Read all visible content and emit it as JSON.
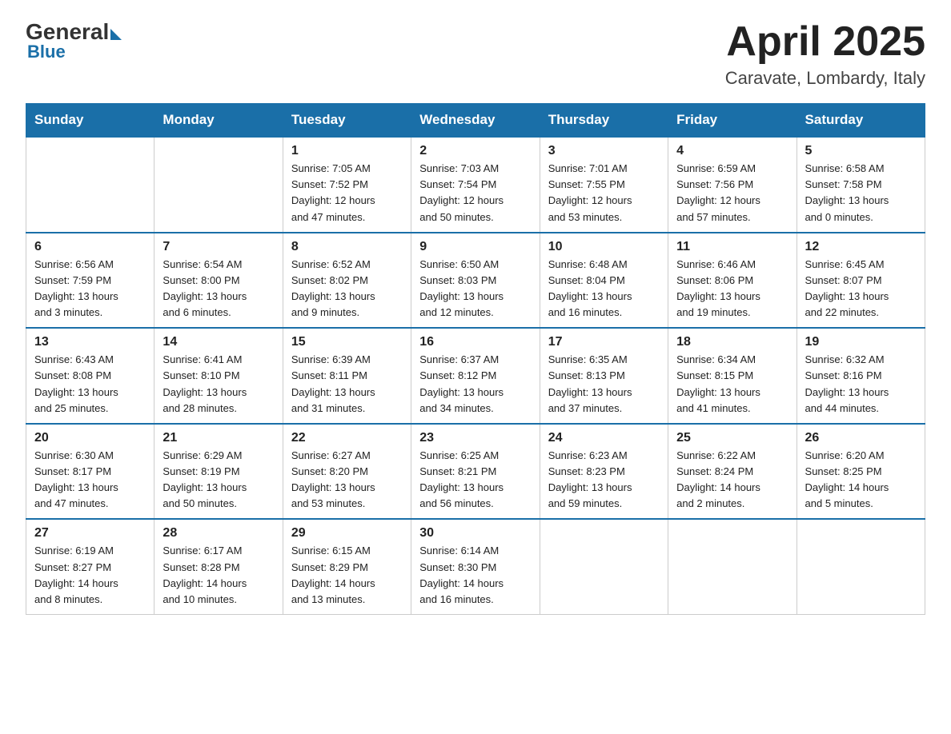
{
  "logo": {
    "general": "General",
    "triangle": "",
    "blue": "Blue"
  },
  "header": {
    "title": "April 2025",
    "subtitle": "Caravate, Lombardy, Italy"
  },
  "weekdays": [
    "Sunday",
    "Monday",
    "Tuesday",
    "Wednesday",
    "Thursday",
    "Friday",
    "Saturday"
  ],
  "weeks": [
    [
      {
        "day": "",
        "info": ""
      },
      {
        "day": "",
        "info": ""
      },
      {
        "day": "1",
        "info": "Sunrise: 7:05 AM\nSunset: 7:52 PM\nDaylight: 12 hours\nand 47 minutes."
      },
      {
        "day": "2",
        "info": "Sunrise: 7:03 AM\nSunset: 7:54 PM\nDaylight: 12 hours\nand 50 minutes."
      },
      {
        "day": "3",
        "info": "Sunrise: 7:01 AM\nSunset: 7:55 PM\nDaylight: 12 hours\nand 53 minutes."
      },
      {
        "day": "4",
        "info": "Sunrise: 6:59 AM\nSunset: 7:56 PM\nDaylight: 12 hours\nand 57 minutes."
      },
      {
        "day": "5",
        "info": "Sunrise: 6:58 AM\nSunset: 7:58 PM\nDaylight: 13 hours\nand 0 minutes."
      }
    ],
    [
      {
        "day": "6",
        "info": "Sunrise: 6:56 AM\nSunset: 7:59 PM\nDaylight: 13 hours\nand 3 minutes."
      },
      {
        "day": "7",
        "info": "Sunrise: 6:54 AM\nSunset: 8:00 PM\nDaylight: 13 hours\nand 6 minutes."
      },
      {
        "day": "8",
        "info": "Sunrise: 6:52 AM\nSunset: 8:02 PM\nDaylight: 13 hours\nand 9 minutes."
      },
      {
        "day": "9",
        "info": "Sunrise: 6:50 AM\nSunset: 8:03 PM\nDaylight: 13 hours\nand 12 minutes."
      },
      {
        "day": "10",
        "info": "Sunrise: 6:48 AM\nSunset: 8:04 PM\nDaylight: 13 hours\nand 16 minutes."
      },
      {
        "day": "11",
        "info": "Sunrise: 6:46 AM\nSunset: 8:06 PM\nDaylight: 13 hours\nand 19 minutes."
      },
      {
        "day": "12",
        "info": "Sunrise: 6:45 AM\nSunset: 8:07 PM\nDaylight: 13 hours\nand 22 minutes."
      }
    ],
    [
      {
        "day": "13",
        "info": "Sunrise: 6:43 AM\nSunset: 8:08 PM\nDaylight: 13 hours\nand 25 minutes."
      },
      {
        "day": "14",
        "info": "Sunrise: 6:41 AM\nSunset: 8:10 PM\nDaylight: 13 hours\nand 28 minutes."
      },
      {
        "day": "15",
        "info": "Sunrise: 6:39 AM\nSunset: 8:11 PM\nDaylight: 13 hours\nand 31 minutes."
      },
      {
        "day": "16",
        "info": "Sunrise: 6:37 AM\nSunset: 8:12 PM\nDaylight: 13 hours\nand 34 minutes."
      },
      {
        "day": "17",
        "info": "Sunrise: 6:35 AM\nSunset: 8:13 PM\nDaylight: 13 hours\nand 37 minutes."
      },
      {
        "day": "18",
        "info": "Sunrise: 6:34 AM\nSunset: 8:15 PM\nDaylight: 13 hours\nand 41 minutes."
      },
      {
        "day": "19",
        "info": "Sunrise: 6:32 AM\nSunset: 8:16 PM\nDaylight: 13 hours\nand 44 minutes."
      }
    ],
    [
      {
        "day": "20",
        "info": "Sunrise: 6:30 AM\nSunset: 8:17 PM\nDaylight: 13 hours\nand 47 minutes."
      },
      {
        "day": "21",
        "info": "Sunrise: 6:29 AM\nSunset: 8:19 PM\nDaylight: 13 hours\nand 50 minutes."
      },
      {
        "day": "22",
        "info": "Sunrise: 6:27 AM\nSunset: 8:20 PM\nDaylight: 13 hours\nand 53 minutes."
      },
      {
        "day": "23",
        "info": "Sunrise: 6:25 AM\nSunset: 8:21 PM\nDaylight: 13 hours\nand 56 minutes."
      },
      {
        "day": "24",
        "info": "Sunrise: 6:23 AM\nSunset: 8:23 PM\nDaylight: 13 hours\nand 59 minutes."
      },
      {
        "day": "25",
        "info": "Sunrise: 6:22 AM\nSunset: 8:24 PM\nDaylight: 14 hours\nand 2 minutes."
      },
      {
        "day": "26",
        "info": "Sunrise: 6:20 AM\nSunset: 8:25 PM\nDaylight: 14 hours\nand 5 minutes."
      }
    ],
    [
      {
        "day": "27",
        "info": "Sunrise: 6:19 AM\nSunset: 8:27 PM\nDaylight: 14 hours\nand 8 minutes."
      },
      {
        "day": "28",
        "info": "Sunrise: 6:17 AM\nSunset: 8:28 PM\nDaylight: 14 hours\nand 10 minutes."
      },
      {
        "day": "29",
        "info": "Sunrise: 6:15 AM\nSunset: 8:29 PM\nDaylight: 14 hours\nand 13 minutes."
      },
      {
        "day": "30",
        "info": "Sunrise: 6:14 AM\nSunset: 8:30 PM\nDaylight: 14 hours\nand 16 minutes."
      },
      {
        "day": "",
        "info": ""
      },
      {
        "day": "",
        "info": ""
      },
      {
        "day": "",
        "info": ""
      }
    ]
  ]
}
